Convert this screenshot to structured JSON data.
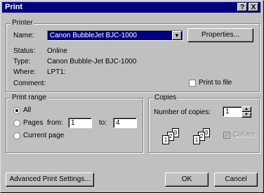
{
  "window": {
    "title": "Print"
  },
  "title_buttons": {
    "help": "?",
    "close": "X"
  },
  "printer": {
    "group_label": "Printer",
    "name_label": "Name:",
    "name_value": "Canon BubbleJet BJC-1000",
    "properties_button": "Properties...",
    "status_label": "Status:",
    "status_value": "Online",
    "type_label": "Type:",
    "type_value": "Canon Bubble-Jet BJC-1000",
    "where_label": "Where:",
    "where_value": "LPT1:",
    "comment_label": "Comment:",
    "print_to_file_label": "Print to file"
  },
  "print_range": {
    "group_label": "Print range",
    "all_label": "All",
    "pages_label": "Pages",
    "from_label": "from:",
    "from_value": "1",
    "to_label": "to:",
    "to_value": "4",
    "selection_label": "Current page",
    "selected": "all"
  },
  "copies": {
    "group_label": "Copies",
    "number_label": "Number of copies:",
    "number_value": "1",
    "collate_label": "Collate",
    "collate_checked": true,
    "collate_disabled": true,
    "page_numbers": [
      "1",
      "2",
      "3"
    ]
  },
  "footer": {
    "advanced_button": "Advanced Print Settings...",
    "ok_button": "OK",
    "cancel_button": "Cancel"
  }
}
